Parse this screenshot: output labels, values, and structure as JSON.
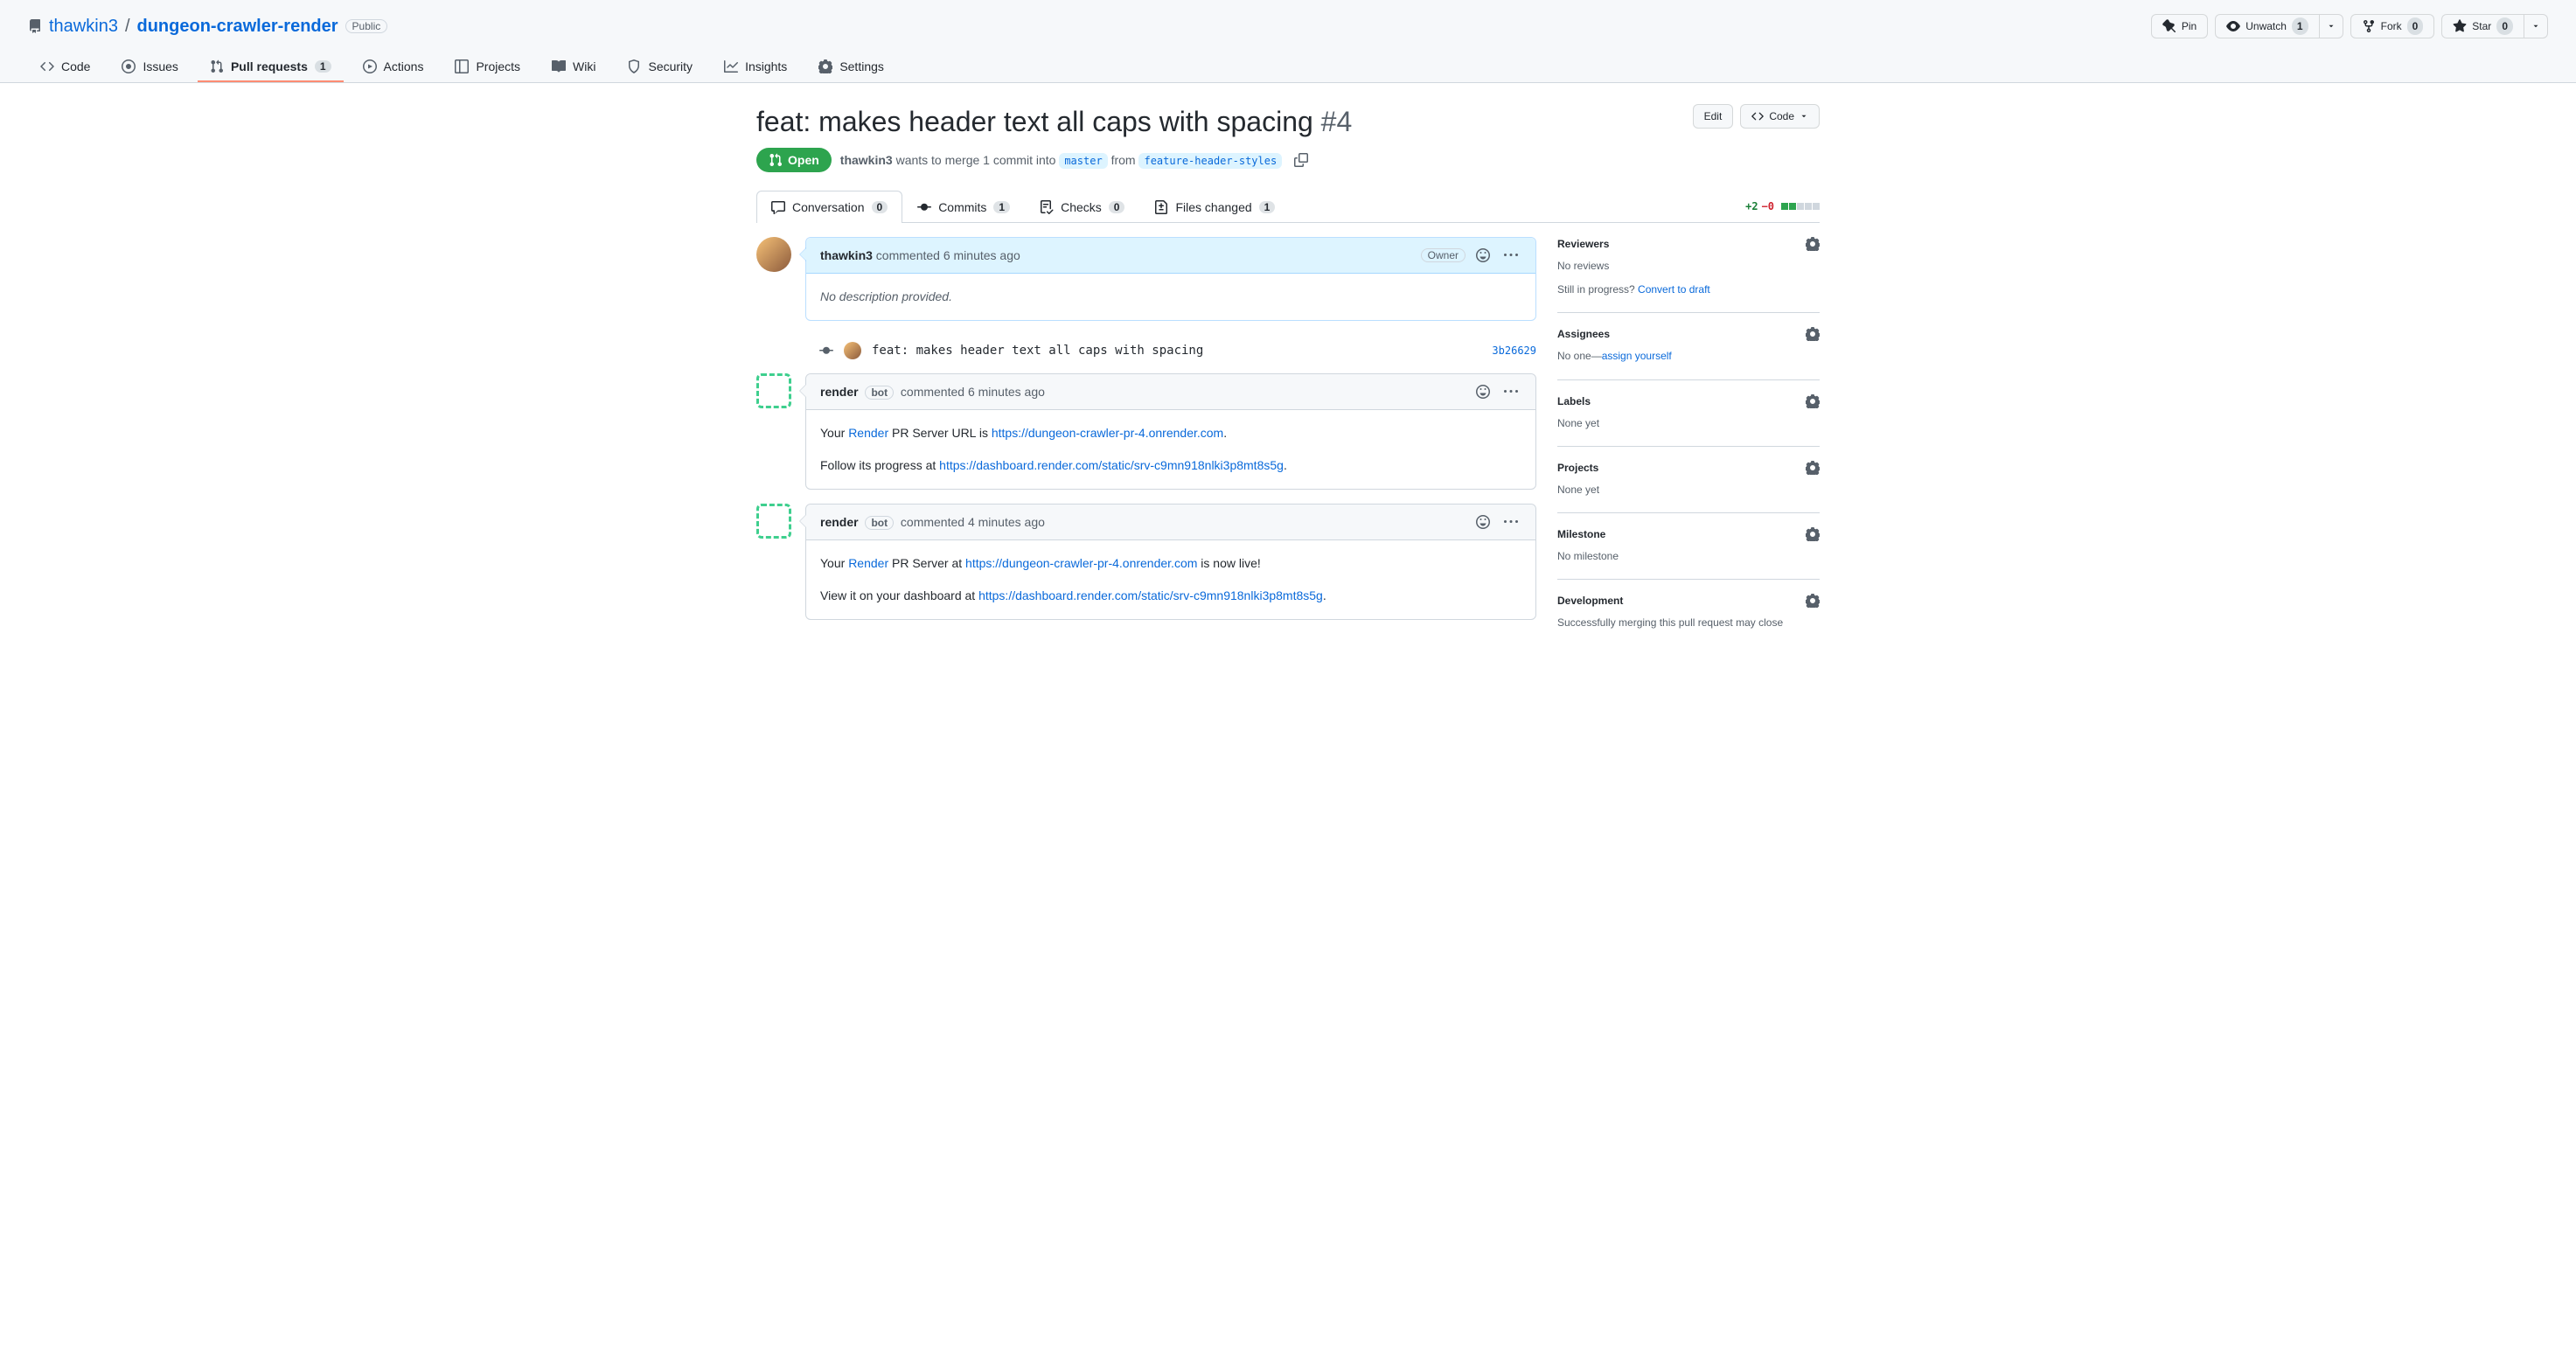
{
  "repo": {
    "owner": "thawkin3",
    "name": "dungeon-crawler-render",
    "visibility": "Public"
  },
  "top_actions": {
    "pin": "Pin",
    "unwatch": "Unwatch",
    "unwatch_count": "1",
    "fork": "Fork",
    "fork_count": "0",
    "star": "Star",
    "star_count": "0"
  },
  "nav": {
    "code": "Code",
    "issues": "Issues",
    "pulls": "Pull requests",
    "pulls_count": "1",
    "actions": "Actions",
    "projects": "Projects",
    "wiki": "Wiki",
    "security": "Security",
    "insights": "Insights",
    "settings": "Settings"
  },
  "pr": {
    "title": "feat: makes header text all caps with spacing",
    "number": "#4",
    "state": "Open",
    "edit": "Edit",
    "code_btn": "Code",
    "meta_author": "thawkin3",
    "meta_prefix": " wants to merge 1 commit into ",
    "base_branch": "master",
    "meta_mid": " from ",
    "head_branch": "feature-header-styles"
  },
  "pr_tabs": {
    "conv": "Conversation",
    "conv_count": "0",
    "commits": "Commits",
    "commits_count": "1",
    "checks": "Checks",
    "checks_count": "0",
    "files": "Files changed",
    "files_count": "1"
  },
  "diff": {
    "add": "+2",
    "del": "−0"
  },
  "comments": {
    "c1_author": "thawkin3",
    "c1_suffix": " commented 6 minutes ago",
    "c1_role": "Owner",
    "c1_body": "No description provided.",
    "commit_msg": "feat: makes header text all caps with spacing",
    "commit_sha": "3b26629",
    "c2_author": "render",
    "c2_bot": "bot",
    "c2_suffix": "commented 6 minutes ago",
    "c2_l1_a": "Your ",
    "c2_l1_render": "Render",
    "c2_l1_b": " PR Server URL is ",
    "c2_l1_url": "https://dungeon-crawler-pr-4.onrender.com",
    "c2_l1_c": ".",
    "c2_l2_a": "Follow its progress at ",
    "c2_l2_url": "https://dashboard.render.com/static/srv-c9mn918nlki3p8mt8s5g",
    "c2_l2_b": ".",
    "c3_author": "render",
    "c3_bot": "bot",
    "c3_suffix": "commented 4 minutes ago",
    "c3_l1_a": "Your ",
    "c3_l1_render": "Render",
    "c3_l1_b": " PR Server at ",
    "c3_l1_url": "https://dungeon-crawler-pr-4.onrender.com",
    "c3_l1_c": " is now live!",
    "c3_l2_a": "View it on your dashboard at ",
    "c3_l2_url": "https://dashboard.render.com/static/srv-c9mn918nlki3p8mt8s5g",
    "c3_l2_b": "."
  },
  "sidebar": {
    "reviewers_h": "Reviewers",
    "reviewers_none": "No reviews",
    "reviewers_draft_a": "Still in progress? ",
    "reviewers_draft_link": "Convert to draft",
    "assignees_h": "Assignees",
    "assignees_none_a": "No one—",
    "assignees_link": "assign yourself",
    "labels_h": "Labels",
    "labels_none": "None yet",
    "projects_h": "Projects",
    "projects_none": "None yet",
    "milestone_h": "Milestone",
    "milestone_none": "No milestone",
    "dev_h": "Development",
    "dev_text": "Successfully merging this pull request may close"
  }
}
